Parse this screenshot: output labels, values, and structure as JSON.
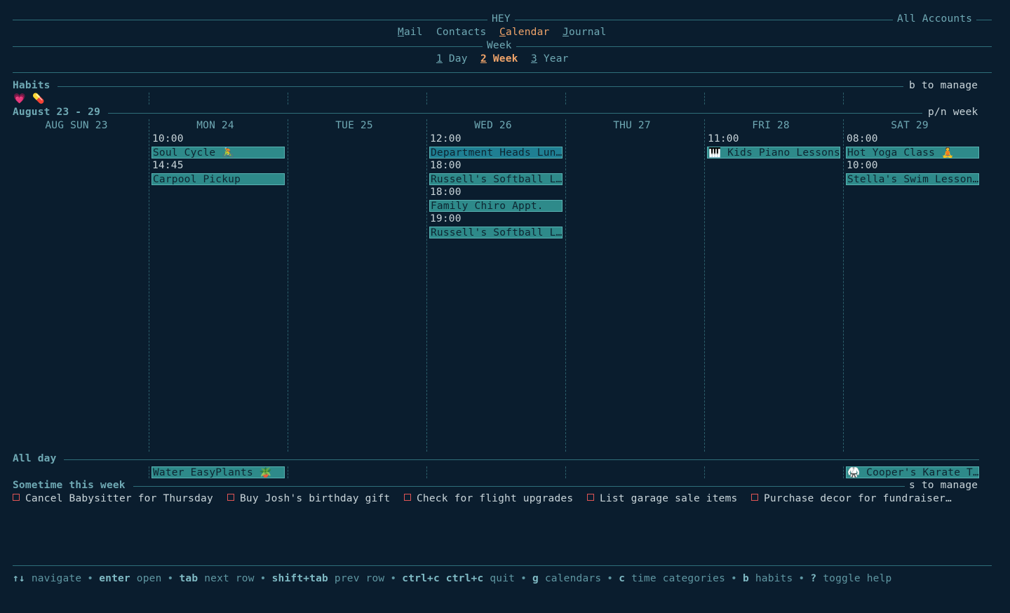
{
  "header": {
    "app_title": "HEY",
    "accounts": "All Accounts",
    "nav": [
      {
        "hot": "M",
        "rest": "ail"
      },
      {
        "hot": "",
        "rest": "Contacts"
      },
      {
        "hot": "C",
        "rest": "alendar"
      },
      {
        "hot": "J",
        "rest": "ournal"
      }
    ],
    "view_title": "Week",
    "views": [
      {
        "num": "1",
        "label": "Day"
      },
      {
        "num": "2",
        "label": "Week"
      },
      {
        "num": "3",
        "label": "Year"
      }
    ]
  },
  "habits": {
    "title": "Habits",
    "hint": "b to manage",
    "icons": [
      "💗",
      "💊"
    ]
  },
  "week": {
    "range": "August 23 - 29",
    "hint": "p/n week",
    "days": [
      {
        "label": "AUG SUN 23",
        "events": []
      },
      {
        "label": "MON 24",
        "events": [
          {
            "time": "10:00",
            "title": "Soul Cycle 🚴"
          },
          {
            "time": "14:45",
            "title": "Carpool Pickup"
          }
        ]
      },
      {
        "label": "TUE 25",
        "events": []
      },
      {
        "label": "WED 26",
        "events": [
          {
            "time": "12:00",
            "title": "Department Heads Lun…"
          },
          {
            "time": "18:00",
            "title": "Russell's Softball L…"
          },
          {
            "time": "18:00",
            "title": "Family Chiro Appt."
          },
          {
            "time": "19:00",
            "title": "Russell's Softball L…"
          }
        ]
      },
      {
        "label": "THU 27",
        "events": []
      },
      {
        "label": "FRI 28",
        "events": [
          {
            "time": "11:00",
            "title": "🎹 Kids Piano Lessons"
          }
        ]
      },
      {
        "label": "SAT 29",
        "events": [
          {
            "time": "08:00",
            "title": "Hot Yoga Class 🧘"
          },
          {
            "time": "10:00",
            "title": "Stella's Swim Lesson…"
          }
        ]
      }
    ]
  },
  "all_day": {
    "title": "All day",
    "events": [
      {
        "day": "MON 24",
        "title": "Water EasyPlants 🪴"
      },
      {
        "day": "SAT 29",
        "title": "🥋 Cooper's Karate T…"
      }
    ]
  },
  "sometime": {
    "title": "Sometime this week",
    "hint": "s to manage",
    "tasks": [
      "Cancel Babysitter for Thursday",
      "Buy Josh's birthday gift",
      "Check for flight upgrades",
      "List garage sale items",
      "Purchase decor for fundraiser…"
    ]
  },
  "help": [
    {
      "key": "↑↓",
      "desc": "navigate"
    },
    {
      "key": "enter",
      "desc": "open"
    },
    {
      "key": "tab",
      "desc": "next row"
    },
    {
      "key": "shift+tab",
      "desc": "prev row"
    },
    {
      "key": "ctrl+c ctrl+c",
      "desc": "quit"
    },
    {
      "key": "g",
      "desc": "calendars"
    },
    {
      "key": "c",
      "desc": "time categories"
    },
    {
      "key": "b",
      "desc": "habits"
    },
    {
      "key": "?",
      "desc": "toggle help"
    }
  ],
  "colors": {
    "background": "#0a1d2e",
    "accent_orange": "#f0a46a",
    "event_fill": "#2e8a8a",
    "event_fill_selected": "#1f7f93",
    "line": "#2f6f7a",
    "task_checkbox": "#e05555"
  }
}
